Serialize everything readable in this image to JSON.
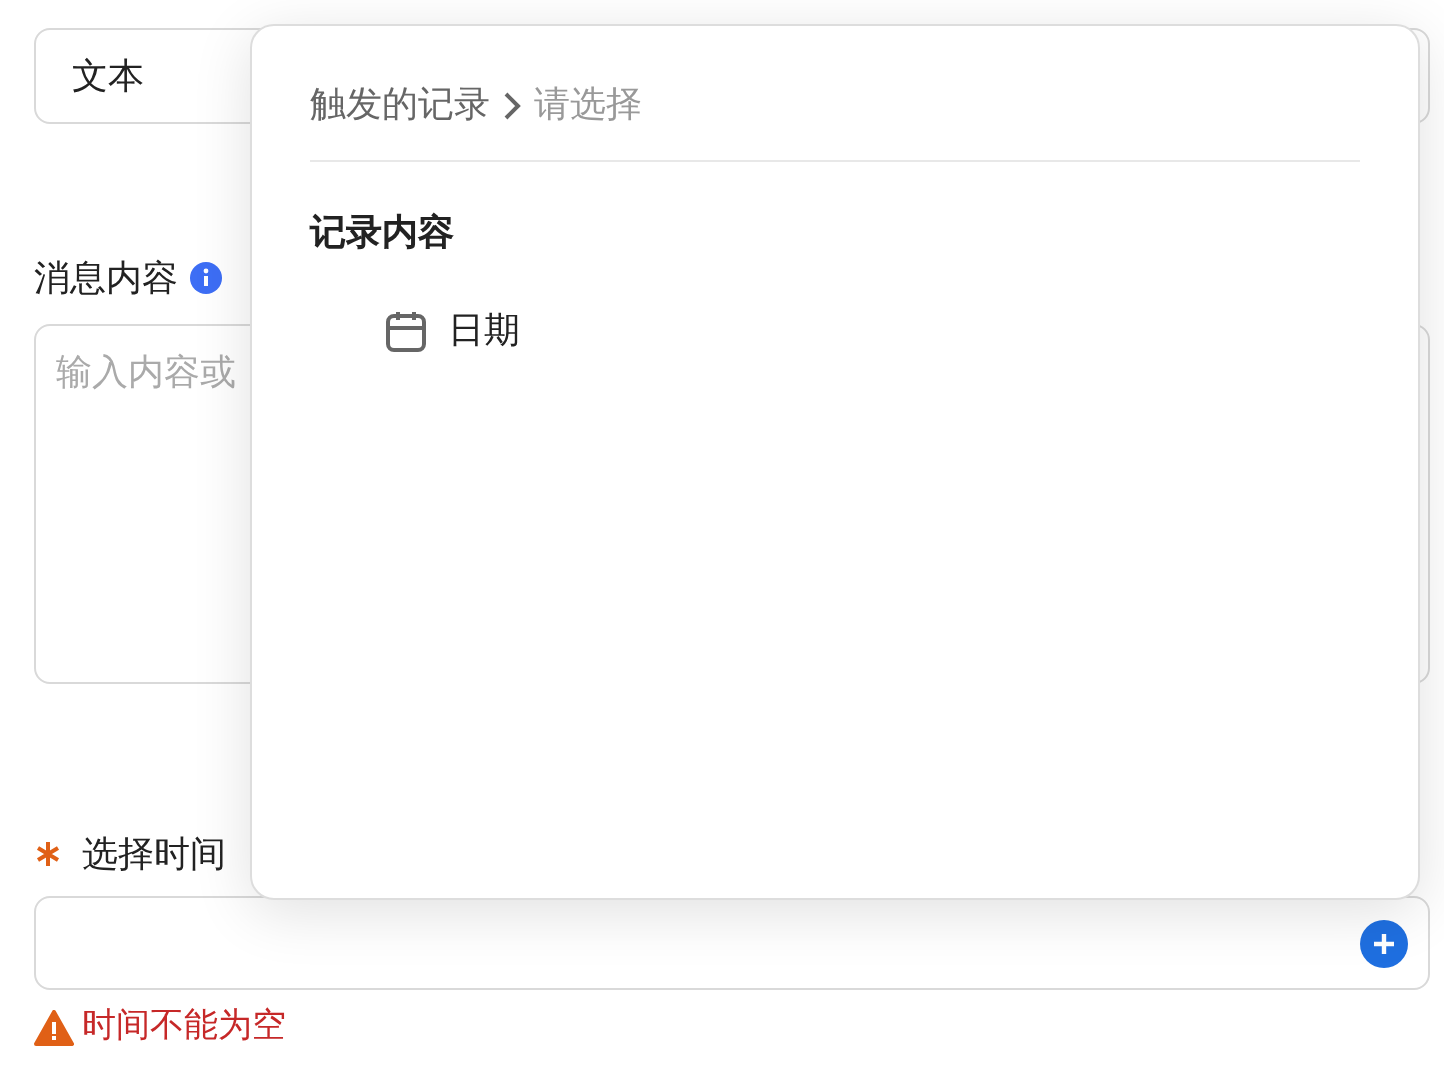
{
  "type_field": {
    "value": "文本"
  },
  "message": {
    "label": "消息内容",
    "placeholder": "输入内容或"
  },
  "time": {
    "label": "选择时间",
    "required": true,
    "error": "时间不能为空"
  },
  "popup": {
    "breadcrumb": [
      {
        "label": "触发的记录",
        "current": false
      },
      {
        "label": "请选择",
        "current": true
      }
    ],
    "groups": [
      {
        "title": "记录内容",
        "items": [
          {
            "label": "日期",
            "kind": "date"
          }
        ]
      }
    ]
  }
}
